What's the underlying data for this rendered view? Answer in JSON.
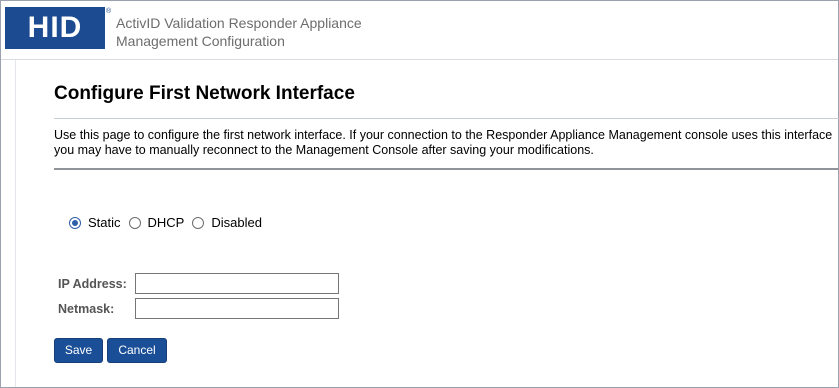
{
  "header": {
    "logo_text": "HID",
    "logo_reg": "®",
    "title_line1": "ActivID Validation Responder Appliance",
    "title_line2": "Management Configuration"
  },
  "page": {
    "title": "Configure First Network Interface",
    "description": "Use this page to configure the first network interface. If your connection to the Responder Appliance Management console uses this interface you may have to manually reconnect to the Management Console after saving your modifications."
  },
  "mode": {
    "options": [
      {
        "label": "Static",
        "selected": true
      },
      {
        "label": "DHCP",
        "selected": false
      },
      {
        "label": "Disabled",
        "selected": false
      }
    ]
  },
  "form": {
    "ip_label": "IP Address:",
    "ip_value": "",
    "netmask_label": "Netmask:",
    "netmask_value": ""
  },
  "buttons": {
    "save": "Save",
    "cancel": "Cancel"
  },
  "colors": {
    "brand": "#1c4b92",
    "button": "#1a4f97"
  }
}
